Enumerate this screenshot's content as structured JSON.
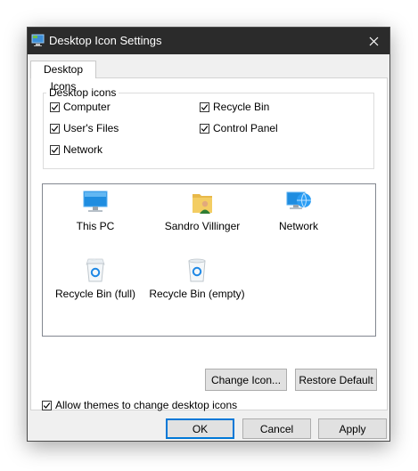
{
  "window": {
    "title": "Desktop Icon Settings"
  },
  "tab": {
    "label": "Desktop Icons"
  },
  "group": {
    "legend": "Desktop icons",
    "checkboxes": [
      {
        "label": "Computer",
        "checked": true
      },
      {
        "label": "Recycle Bin",
        "checked": true
      },
      {
        "label": "User's Files",
        "checked": true
      },
      {
        "label": "Control Panel",
        "checked": true
      },
      {
        "label": "Network",
        "checked": true
      }
    ]
  },
  "icons": [
    {
      "label": "This PC",
      "icon": "computer-icon"
    },
    {
      "label": "Sandro Villinger",
      "icon": "user-folder-icon"
    },
    {
      "label": "Network",
      "icon": "network-icon"
    },
    {
      "label": "Recycle Bin (full)",
      "icon": "recycle-bin-full-icon"
    },
    {
      "label": "Recycle Bin (empty)",
      "icon": "recycle-bin-empty-icon"
    }
  ],
  "buttons": {
    "change_icon": "Change Icon...",
    "restore_default": "Restore Default",
    "ok": "OK",
    "cancel": "Cancel",
    "apply": "Apply"
  },
  "themes": {
    "label": "Allow themes to change desktop icons",
    "checked": true
  }
}
